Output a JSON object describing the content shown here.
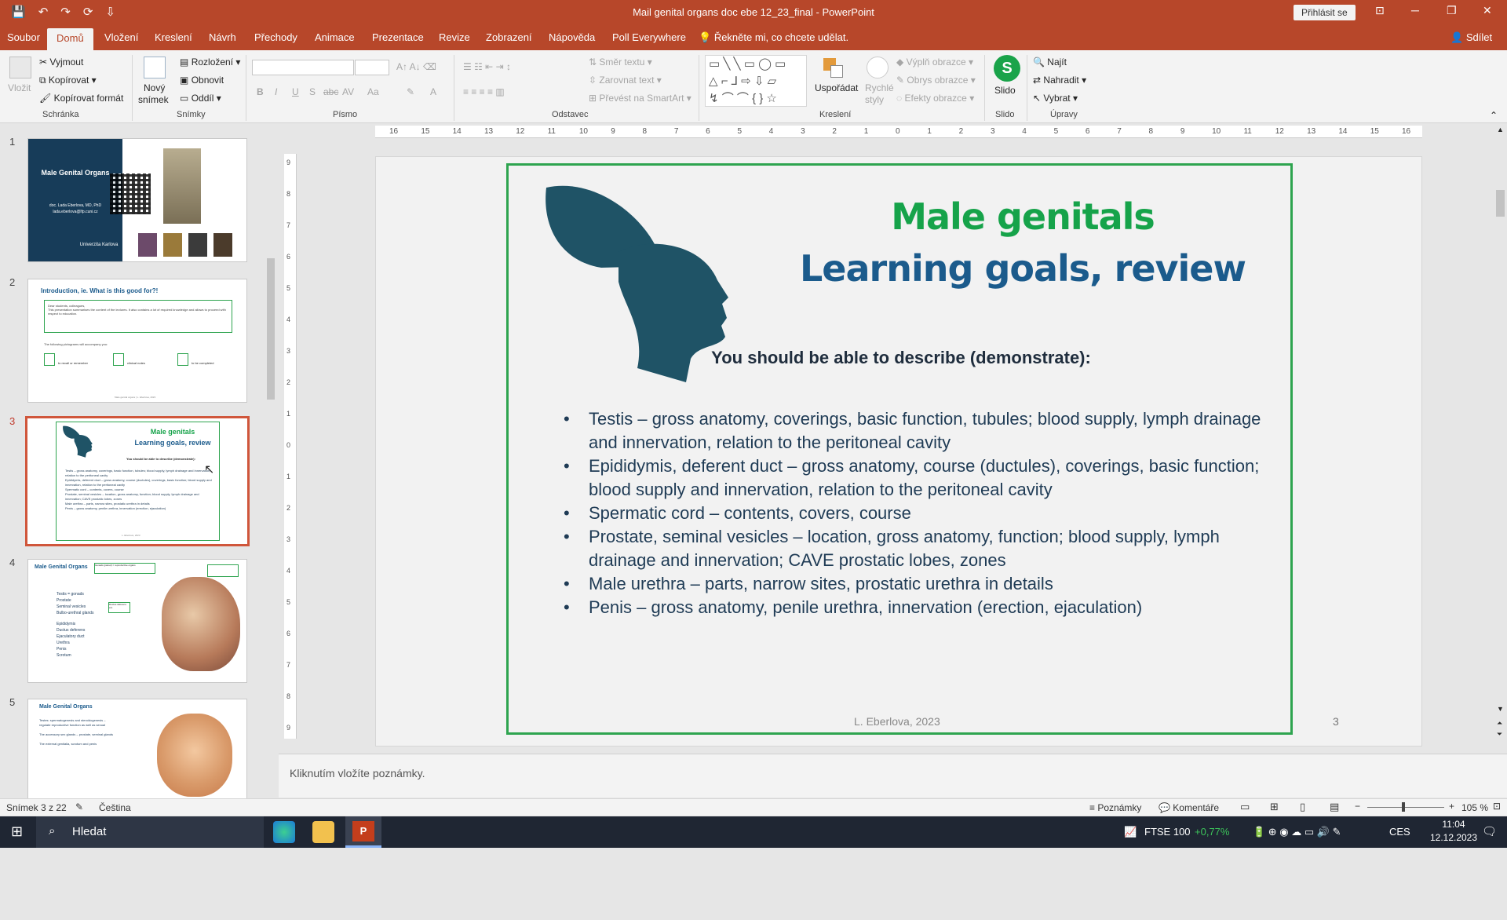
{
  "window": {
    "title": "Mail genital organs doc ebe 12_23_final  -  PowerPoint",
    "signin": "Přihlásit se",
    "qat": [
      "💾",
      "↶",
      "↷",
      "⟳",
      "⇩"
    ],
    "controls": [
      "⊡",
      "─",
      "❐",
      "✕"
    ]
  },
  "tabs": [
    "Soubor",
    "Domů",
    "Vložení",
    "Kreslení",
    "Návrh",
    "Přechody",
    "Animace",
    "Prezentace",
    "Revize",
    "Zobrazení",
    "Nápověda",
    "Poll Everywhere"
  ],
  "tell_me": "Řekněte mi, co chcete udělat.",
  "share": "Sdílet",
  "ribbon": {
    "clipboard": {
      "label": "Schránka",
      "paste": "Vložit",
      "cut": "Vyjmout",
      "copy": "Kopírovat",
      "format": "Kopírovat formát"
    },
    "slides": {
      "label": "Snímky",
      "new1": "Nový",
      "new2": "snímek",
      "layout": "Rozložení",
      "reset": "Obnovit",
      "section": "Oddíl"
    },
    "font": {
      "label": "Písmo",
      "b": "B",
      "i": "I",
      "u": "U",
      "s": "S",
      "abc": "abc",
      "av": "AV",
      "aa": "Aa",
      "a": "A"
    },
    "paragraph": {
      "label": "Odstavec",
      "dir": "Směr textu",
      "align": "Zarovnat text",
      "smart": "Převést na SmartArt"
    },
    "drawing": {
      "label": "Kreslení",
      "arrange": "Uspořádat",
      "styles1": "Rychlé",
      "styles2": "styly",
      "fill": "Výplň obrazce",
      "outline": "Obrys obrazce",
      "effects": "Efekty obrazce"
    },
    "slido": {
      "label": "Slido",
      "name": "Slido",
      "icon": "S"
    },
    "editing": {
      "label": "Úpravy",
      "find": "Najít",
      "replace": "Nahradit",
      "select": "Vybrat"
    }
  },
  "thumbnails": [
    {
      "num": "1",
      "title": "Male Genital Organs",
      "author": "doc. Lada Eberlova, MD, PhD",
      "email": "lada.eberlova@lfp.cuni.cz",
      "uni": "Univerzita Karlova"
    },
    {
      "num": "2",
      "title": "Introduction, ie. What is this good for?!",
      "text1": "Dear students, colleagues,",
      "text2": "This presentation summarises the content of the lectures. It also contains a lot of required knowledge and allows to proceed with respect to education.",
      "text3": "The following pictograms will accompany you:",
      "i1": "to recall or remember",
      "i2": "clinical notes",
      "i3": "to be completed",
      "footer": "Male genital organs | L. Eberlova, 2023"
    },
    {
      "num": "3",
      "title1": "Male genitals",
      "title2": "Learning goals, review",
      "sub": "You should be able to describe (demonstrate):",
      "footer": "L. Eberlova, 2023"
    },
    {
      "num": "4",
      "title": "Male Genital Organs",
      "box1": "Gonads (paired) = reproductive organs",
      "box2": "Ductus deferens ext.",
      "items": [
        "Testis = gonads",
        "Prostate",
        "Seminal vesicles",
        "Bulbo-urethral glands",
        "Epididymis",
        "Ductus deferens",
        "Ejaculatory duct",
        "Urethra",
        "Penis",
        "Scrotum"
      ]
    },
    {
      "num": "5",
      "title": "Male Genital Organs",
      "text1": "Testes: spermatogenesis and steroidogenesis –",
      "text2": "regulate reproductive function as well as sexual",
      "text3": "The accessory sex glands – prostate, seminal glands",
      "text4": "The external genitalia, scrotum and penis"
    }
  ],
  "slide": {
    "title1": "Male genitals",
    "title2": "Learning goals, review",
    "subtitle": "You should be able to describe (demonstrate):",
    "bullets": [
      "Testis – gross anatomy, coverings, basic function, tubules; blood supply, lymph drainage and innervation, relation to the peritoneal cavity",
      "Epididymis, deferent duct – gross anatomy, course (ductules), coverings, basic function; blood supply and innervation, relation to the peritoneal cavity",
      "Spermatic cord – contents, covers, course",
      "Prostate, seminal vesicles – location, gross anatomy, function; blood supply, lymph drainage and innervation; CAVE prostatic lobes, zones",
      "Male urethra – parts, narrow sites, prostatic urethra in details",
      "Penis – gross anatomy, penile urethra, innervation (erection, ejaculation)"
    ],
    "footer": "L. Eberlova, 2023",
    "number": "3",
    "head_color": "#1f5366"
  },
  "ruler": {
    "h": [
      "16",
      "15",
      "14",
      "13",
      "12",
      "11",
      "10",
      "9",
      "8",
      "7",
      "6",
      "5",
      "4",
      "3",
      "2",
      "1",
      "0",
      "1",
      "2",
      "3",
      "4",
      "5",
      "6",
      "7",
      "8",
      "9",
      "10",
      "11",
      "12",
      "13",
      "14",
      "15",
      "16"
    ],
    "v": [
      "9",
      "8",
      "7",
      "6",
      "5",
      "4",
      "3",
      "2",
      "1",
      "0",
      "1",
      "2",
      "3",
      "4",
      "5",
      "6",
      "7",
      "8",
      "9"
    ]
  },
  "notes_placeholder": "Kliknutím vložíte poznámky.",
  "status": {
    "slide": "Snímek 3 z 22",
    "lang": "Čeština",
    "notes": "Poznámky",
    "comments": "Komentáře",
    "zoom": "105 %"
  },
  "taskbar": {
    "search": "Hledat",
    "ftse": "FTSE 100",
    "ftse_change": "+0,77%",
    "lang": "CES",
    "time": "11:04",
    "date": "12.12.2023"
  }
}
